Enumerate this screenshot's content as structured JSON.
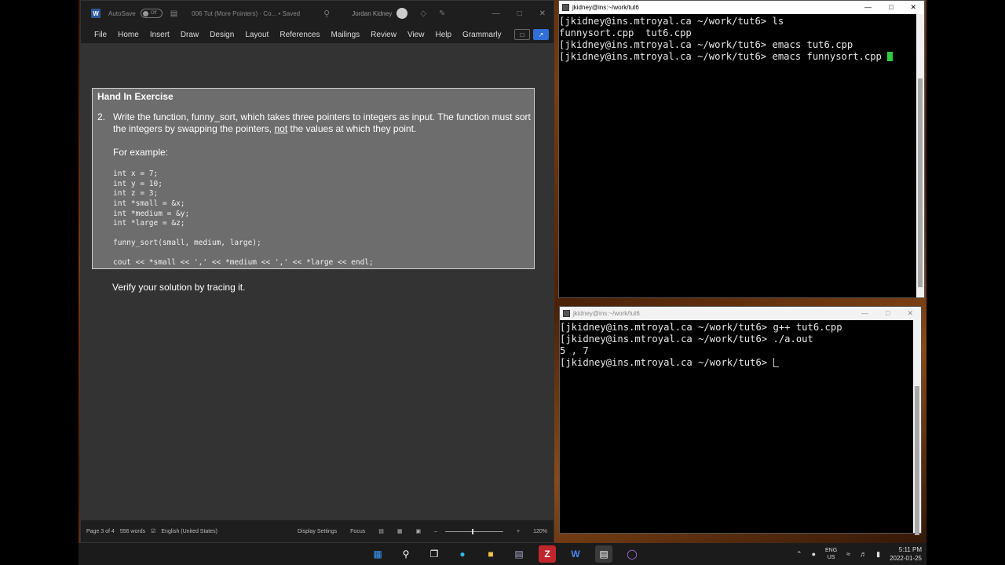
{
  "word": {
    "autosave_label": "AutoSave",
    "autosave_state": "Off",
    "doc_title": "006 Tut (More Pointers) · Co... • Saved",
    "user_name": "Jordan Kidney",
    "ribbon_tabs": [
      "File",
      "Home",
      "Insert",
      "Draw",
      "Design",
      "Layout",
      "References",
      "Mailings",
      "Review",
      "View",
      "Help",
      "Grammarly"
    ],
    "box_title": "Hand In Exercise",
    "question_number": "2.",
    "question_text_a": "Write the function, funny_sort, which takes three pointers to integers as input.  The function must sort the integers by swapping the pointers, ",
    "question_underlined": "not",
    "question_text_b": " the values at which they point.",
    "example_label": "For example:",
    "code_lines": [
      "int x = 7;",
      "int y = 10;",
      "int z = 3;",
      "int *small = &x;",
      "int *medium = &y;",
      "int *large = &z;",
      "",
      "funny_sort(small, medium, large);",
      "",
      "cout << *small << ',' << *medium << ',' << *large << endl;"
    ],
    "verify_text": "Verify your solution by tracing it.",
    "status": {
      "page": "Page 3 of 4",
      "words": "556 words",
      "language": "English (United States)",
      "display_settings": "Display Settings",
      "focus": "Focus",
      "zoom": "120%"
    }
  },
  "terminal_top": {
    "title": "jkidney@ins:~/work/tut6",
    "lines": [
      "[jkidney@ins.mtroyal.ca ~/work/tut6> ls",
      "funnysort.cpp  tut6.cpp",
      "[jkidney@ins.mtroyal.ca ~/work/tut6> emacs tut6.cpp",
      "[jkidney@ins.mtroyal.ca ~/work/tut6> emacs funnysort.cpp "
    ]
  },
  "terminal_bottom": {
    "title": "jkidney@ins:~/work/tut6",
    "lines": [
      "[jkidney@ins.mtroyal.ca ~/work/tut6> g++ tut6.cpp",
      "[jkidney@ins.mtroyal.ca ~/work/tut6> ./a.out",
      "5 , 7",
      "[jkidney@ins.mtroyal.ca ~/work/tut6> "
    ]
  },
  "taskbar": {
    "apps": [
      "windows-start-icon",
      "search-icon",
      "task-view-icon",
      "edge-icon",
      "file-explorer-icon",
      "terminal-app-icon",
      "filezilla-icon",
      "word-icon",
      "putty-icon",
      "app-circle-icon"
    ],
    "lang_line1": "ENG",
    "lang_line2": "US",
    "time": "5:11 PM",
    "date": "2022-01-25"
  }
}
